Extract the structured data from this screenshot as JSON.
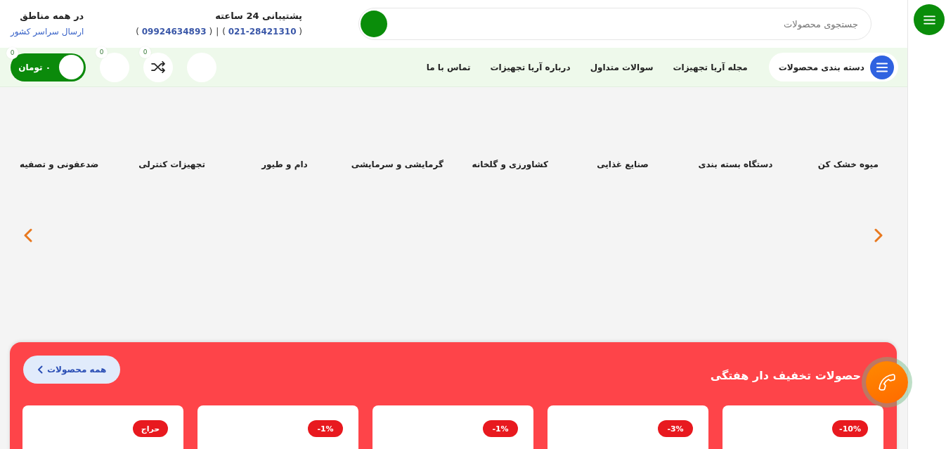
{
  "header": {
    "search": {
      "placeholder": "جستجوی محصولات"
    },
    "support": {
      "title": "پشتیبانی 24 ساعته",
      "phone_line": [
        {
          "kind": "phone",
          "text": "( **021-28421310** )"
        },
        {
          "kind": "separator",
          "text": "|"
        },
        {
          "kind": "phone",
          "text": "( **09924634893** )"
        }
      ]
    },
    "delivery": {
      "title": "در همه مناطق",
      "subtitle": "ارسال سراسر کشور"
    }
  },
  "navbar": {
    "category_button": "دسته بندی محصولات",
    "links": [
      "مجله آریا تجهیزات",
      "سوالات متداول",
      "درباره آریا تجهیزات",
      "تماس با ما"
    ],
    "actions": [
      {
        "kind": "blank"
      },
      {
        "kind": "shuffle",
        "badge": "0"
      },
      {
        "kind": "blank",
        "badge": "0"
      },
      {
        "kind": "cart",
        "label": "۰ تومان",
        "badge": "0"
      }
    ]
  },
  "categories": [
    "میوه خشک کن",
    "دستگاه بسته بندی",
    "صنایع غذایی",
    "کشاورزی و گلخانه",
    "گرمایشی و سرمایشی",
    "دام و طیور",
    "تجهیزات کنترلی",
    "ضدعفونی و تصفیه"
  ],
  "weekly_deals": {
    "title": "حصولات تخفیف دار هفتگی",
    "all_button": "همه محصولات",
    "products": [
      {
        "badge": "-10%"
      },
      {
        "badge": "-3%"
      },
      {
        "badge": "-1%"
      },
      {
        "badge": "-1%"
      },
      {
        "badge": "حراج"
      }
    ]
  }
}
